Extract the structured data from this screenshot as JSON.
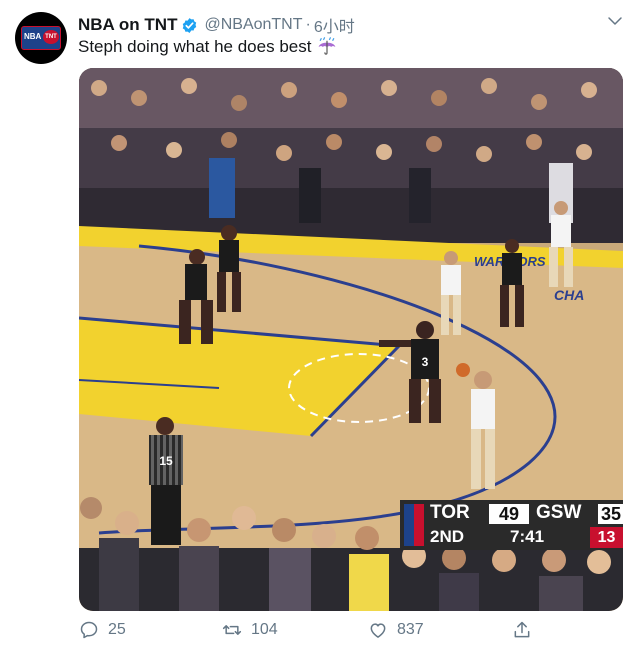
{
  "tweet": {
    "author_name": "NBA on TNT",
    "handle": "@NBAonTNT",
    "separator": "·",
    "time": "6小时",
    "text": "Steph doing what he does best",
    "avatar_text_left": "NBA",
    "avatar_text_right": "TNT"
  },
  "media": {
    "jersey_number_referee": "15",
    "jersey_number_defender": "3",
    "court_text": "WARRIORS",
    "court_text_right": "CHA",
    "scorebug": {
      "team_away": "TOR",
      "score_away": "49",
      "team_home": "GSW",
      "score_home": "35",
      "quarter": "2ND",
      "game_clock": "7:41",
      "shot_clock": "13"
    }
  },
  "actions": {
    "replies": "25",
    "retweets": "104",
    "likes": "837"
  },
  "colors": {
    "text_primary": "#14171a",
    "text_secondary": "#657786",
    "verified_blue": "#1da1f2",
    "court_yellow": "#f2d22e",
    "court_wood": "#d9b887"
  }
}
